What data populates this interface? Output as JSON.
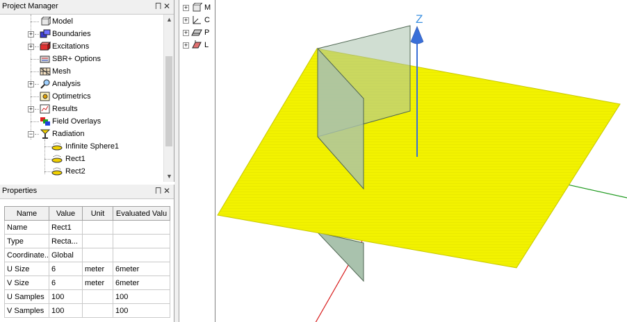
{
  "project_manager": {
    "title": "Project Manager",
    "pin_glyph": "⨅",
    "close_glyph": "✕",
    "tree": [
      {
        "label": "Model",
        "icon": "model-icon",
        "expander": ""
      },
      {
        "label": "Boundaries",
        "icon": "boundaries-icon",
        "expander": "+"
      },
      {
        "label": "Excitations",
        "icon": "excitations-icon",
        "expander": "+"
      },
      {
        "label": "SBR+ Options",
        "icon": "sbr-options-icon",
        "expander": ""
      },
      {
        "label": "Mesh",
        "icon": "mesh-icon",
        "expander": ""
      },
      {
        "label": "Analysis",
        "icon": "analysis-icon",
        "expander": "+"
      },
      {
        "label": "Optimetrics",
        "icon": "optimetrics-icon",
        "expander": ""
      },
      {
        "label": "Results",
        "icon": "results-icon",
        "expander": "+"
      },
      {
        "label": "Field Overlays",
        "icon": "field-overlays-icon",
        "expander": ""
      },
      {
        "label": "Radiation",
        "icon": "radiation-icon",
        "expander": "−"
      },
      {
        "label": "Infinite Sphere1",
        "icon": "infinite-sphere-icon",
        "expander": ""
      },
      {
        "label": "Rect1",
        "icon": "rect-setup-icon",
        "expander": ""
      },
      {
        "label": "Rect2",
        "icon": "rect-setup-icon",
        "expander": ""
      }
    ]
  },
  "properties": {
    "title": "Properties",
    "pin_glyph": "⨅",
    "close_glyph": "✕",
    "columns": [
      "Name",
      "Value",
      "Unit",
      "Evaluated Valu"
    ],
    "rows": [
      [
        "Name",
        "Rect1",
        "",
        ""
      ],
      [
        "Type",
        "Recta...",
        "",
        ""
      ],
      [
        "Coordinate...",
        "Global",
        "",
        ""
      ],
      [
        "U Size",
        "6",
        "meter",
        "6meter"
      ],
      [
        "V Size",
        "6",
        "meter",
        "6meter"
      ],
      [
        "U Samples",
        "100",
        "",
        "100"
      ],
      [
        "V Samples",
        "100",
        "",
        "100"
      ]
    ]
  },
  "model_tree": [
    {
      "label": "M",
      "icon": "model-3d-icon",
      "expander": "+"
    },
    {
      "label": "C",
      "icon": "coordinate-systems-icon",
      "expander": "+"
    },
    {
      "label": "P",
      "icon": "planes-icon",
      "expander": "+"
    },
    {
      "label": "L",
      "icon": "lists-icon",
      "expander": "+"
    }
  ],
  "view3d": {
    "axis_label": "Z",
    "colors": {
      "plane_yellow": "#f2f200",
      "plane_edge": "#c8c800",
      "panel_green": "#a9c2ad",
      "axis_x": "#d81b1b",
      "axis_y": "#1f9a1f",
      "axis_z": "#3a6fd8",
      "z_label": "#3a8fe0"
    }
  }
}
